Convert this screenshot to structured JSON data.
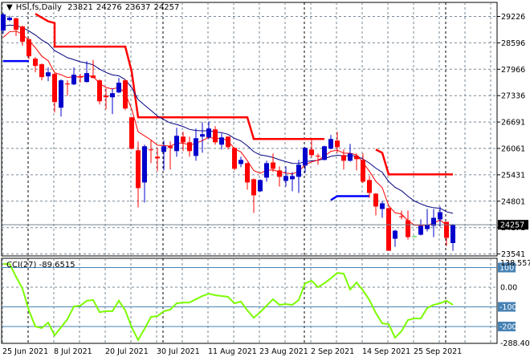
{
  "header": {
    "symbol": "HSI,fs,Daily",
    "open": "23821",
    "high": "24276",
    "low": "23637",
    "close": "24257",
    "menu_icon": "triangle-down-icon"
  },
  "colors": {
    "bull": "#0000cc",
    "bear": "#ff0000",
    "doji": "#33cc33",
    "ma_fast": "#ff0000",
    "ma_slow": "#000080",
    "cci": "#7cfc00",
    "levels": "#4682b4",
    "grid": "#7a8896"
  },
  "chart_data": [
    {
      "type": "candlestick",
      "title": "HSI,fs,Daily",
      "ylim": [
        23541,
        29226
      ],
      "y_ticks": [
        "29226",
        "28596",
        "27966",
        "27336",
        "26691",
        "26061",
        "25431",
        "24801",
        "24171",
        "23541"
      ],
      "current_price": "24257",
      "x_ticks": [
        {
          "index": 0,
          "label": "25 Jun 2021"
        },
        {
          "index": 8,
          "label": "8 Jul 2021"
        },
        {
          "index": 16,
          "label": "20 Jul 2021"
        },
        {
          "index": 24,
          "label": "30 Jul 2021"
        },
        {
          "index": 32,
          "label": "11 Aug 2021"
        },
        {
          "index": 40,
          "label": "23 Aug 2021"
        },
        {
          "index": 48,
          "label": "2 Sep 2021"
        },
        {
          "index": 56,
          "label": "14 Sep 2021"
        },
        {
          "index": 64,
          "label": "25 Sep 2021"
        }
      ],
      "ohlc": [
        [
          28882,
          29300,
          28800,
          29264
        ],
        [
          29130,
          29230,
          29100,
          29188
        ],
        [
          29169,
          29188,
          28748,
          28901
        ],
        [
          28977,
          29000,
          28518,
          28614
        ],
        [
          28671,
          28700,
          28200,
          28269
        ],
        [
          28212,
          28250,
          27886,
          28040
        ],
        [
          28078,
          28100,
          27695,
          27772
        ],
        [
          27791,
          28001,
          27676,
          27886
        ],
        [
          27848,
          27870,
          26929,
          27178
        ],
        [
          27044,
          27720,
          26834,
          27695
        ],
        [
          27620,
          27695,
          27331,
          27599
        ],
        [
          27599,
          28001,
          27580,
          27829
        ],
        [
          27780,
          27848,
          27638,
          27772
        ],
        [
          27657,
          28150,
          27640,
          27867
        ],
        [
          27810,
          28180,
          27740,
          27752
        ],
        [
          27695,
          27720,
          27121,
          27197
        ],
        [
          27331,
          27504,
          27006,
          27293
        ],
        [
          27293,
          27504,
          26891,
          27389
        ],
        [
          27408,
          27752,
          27390,
          27638
        ],
        [
          27695,
          27720,
          26987,
          27025
        ],
        [
          26815,
          26830,
          26050,
          26068
        ],
        [
          26030,
          26240,
          24671,
          25130
        ],
        [
          25264,
          26164,
          24786,
          26126
        ],
        [
          26049,
          26279,
          25724,
          26030
        ],
        [
          25877,
          26087,
          25532,
          25838
        ],
        [
          25992,
          26260,
          25551,
          26126
        ],
        [
          26126,
          26240,
          25570,
          26087
        ],
        [
          26011,
          26566,
          25877,
          26374
        ],
        [
          26355,
          26470,
          26011,
          26221
        ],
        [
          26221,
          26355,
          25877,
          26011
        ],
        [
          25896,
          26547,
          25781,
          26317
        ],
        [
          26355,
          26700,
          25972,
          26413
        ],
        [
          26336,
          26719,
          26300,
          26547
        ],
        [
          26528,
          26604,
          26164,
          26221
        ],
        [
          26164,
          26432,
          26049,
          26336
        ],
        [
          26355,
          26360,
          26049,
          26106
        ],
        [
          26087,
          26100,
          25551,
          25590
        ],
        [
          25704,
          25877,
          25628,
          25800
        ],
        [
          25724,
          25740,
          25092,
          25264
        ],
        [
          25341,
          25360,
          24537,
          24958
        ],
        [
          25054,
          25340,
          25040,
          25322
        ],
        [
          25379,
          25781,
          25283,
          25724
        ],
        [
          25740,
          25953,
          25513,
          25590
        ],
        [
          25551,
          25647,
          25168,
          25398
        ],
        [
          25302,
          25647,
          25168,
          25417
        ],
        [
          25341,
          25513,
          25054,
          25417
        ],
        [
          25398,
          25800,
          25015,
          25685
        ],
        [
          25666,
          26100,
          25494,
          26087
        ],
        [
          26049,
          26279,
          25858,
          25915
        ],
        [
          25900,
          25953,
          25685,
          25896
        ],
        [
          25800,
          26140,
          25790,
          26126
        ],
        [
          26068,
          26394,
          26050,
          26298
        ],
        [
          26260,
          26470,
          25972,
          26106
        ],
        [
          25915,
          26049,
          25570,
          25781
        ],
        [
          25781,
          26183,
          25760,
          25953
        ],
        [
          25896,
          25953,
          25551,
          25819
        ],
        [
          25800,
          25953,
          25250,
          25283
        ],
        [
          25322,
          25417,
          24900,
          25015
        ],
        [
          24996,
          25015,
          24480,
          24690
        ],
        [
          24633,
          24824,
          24422,
          24767
        ],
        [
          24652,
          24670,
          23637,
          23637
        ],
        [
          23924,
          24135,
          23733,
          24116
        ],
        [
          24460,
          24594,
          24384,
          24441
        ],
        [
          24365,
          24594,
          23905,
          23963
        ],
        [
          23982,
          23990,
          23975,
          23982
        ],
        [
          24020,
          24384,
          24001,
          24231
        ],
        [
          24154,
          24633,
          24097,
          24250
        ],
        [
          24231,
          24633,
          23963,
          24422
        ],
        [
          24384,
          24690,
          24212,
          24556
        ],
        [
          24326,
          24326,
          23752,
          23944
        ],
        [
          23821,
          24276,
          23637,
          24257
        ]
      ],
      "resistance_line": [
        [
          [
            5,
            29280
          ],
          [
            7,
            29100
          ],
          [
            8,
            29060
          ],
          [
            8,
            28499
          ],
          [
            19,
            28499
          ],
          [
            20,
            27900
          ],
          [
            21,
            26815
          ],
          [
            38,
            26815
          ],
          [
            39,
            26298
          ],
          [
            50,
            26298
          ]
        ],
        [
          [
            58,
            26049
          ],
          [
            59,
            25970
          ],
          [
            60,
            25456
          ],
          [
            70,
            25456
          ]
        ]
      ],
      "support_line": [
        [
          [
            0,
            28154
          ],
          [
            4,
            28154
          ]
        ],
        [
          [
            51,
            24844
          ],
          [
            52,
            24939
          ],
          [
            57,
            24939
          ]
        ]
      ]
    },
    {
      "type": "line",
      "title": "CCI(27)",
      "value_label": "-89.6515",
      "ylim": [
        -288.404,
        138.557
      ],
      "y_ticks": [
        "138.557",
        "0.00",
        "-288.404"
      ],
      "levels": [
        {
          "value": 100,
          "label": "100"
        },
        {
          "value": -100,
          "label": "-100"
        },
        {
          "value": -200,
          "label": "-200"
        }
      ],
      "values": [
        118,
        118,
        53,
        -8,
        -118,
        -200,
        -208,
        -180,
        -245,
        -204,
        -163,
        -98,
        -94,
        -69,
        -65,
        -127,
        -122,
        -122,
        -69,
        -118,
        -204,
        -269,
        -212,
        -151,
        -147,
        -122,
        -114,
        -82,
        -78,
        -78,
        -61,
        -45,
        -33,
        -41,
        -45,
        -49,
        -82,
        -73,
        -118,
        -155,
        -127,
        -94,
        -61,
        -90,
        -86,
        -90,
        -65,
        20,
        33,
        0,
        20,
        45,
        73,
        69,
        -12,
        24,
        -16,
        -65,
        -131,
        -184,
        -188,
        -257,
        -224,
        -167,
        -159,
        -159,
        -106,
        -90,
        -82,
        -69,
        -89.6515
      ]
    }
  ]
}
